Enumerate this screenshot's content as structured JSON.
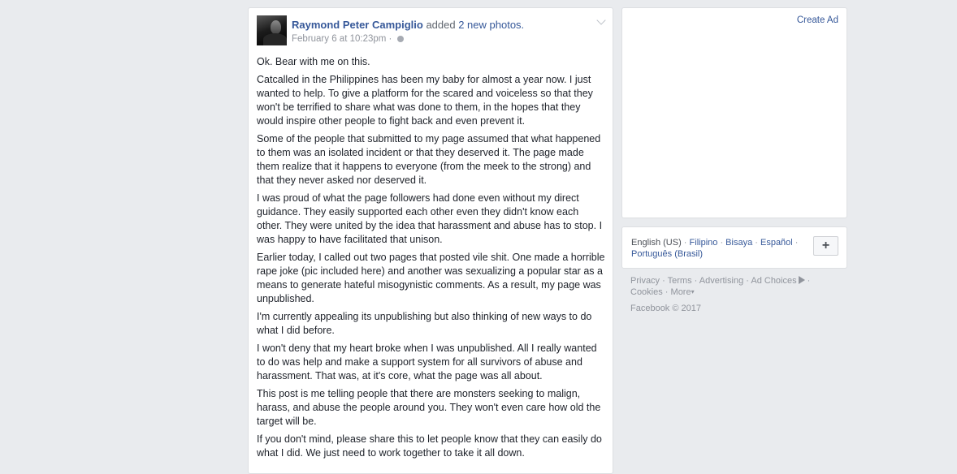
{
  "post": {
    "author": "Raymond Peter Campiglio",
    "action": "added",
    "photos_link": "2 new photos.",
    "timestamp": "February 6 at 10:23pm",
    "separator": "·",
    "paragraphs": [
      "Ok. Bear with me on this.",
      "Catcalled in the Philippines has been my baby for almost a year now. I just wanted to help. To give a platform for the scared and voiceless so that they won't be terrified to share what was done to them, in the hopes that they would inspire other people to fight back and even prevent it.",
      "Some of the people that submitted to my page assumed that what happened to them was an isolated incident or that they deserved it. The page made them realize that it happens to everyone (from the meek to the strong) and that they never asked nor deserved it.",
      "I was proud of what the page followers had done even without my direct guidance. They easily supported each other even they didn't know each other. They were united by the idea that harassment and abuse has to stop. I was happy to have facilitated that unison.",
      "Earlier today, I called out two pages that posted vile shit. One made a horrible rape joke (pic included here) and another was sexualizing a popular star as a means to generate hateful misogynistic comments. As a result, my page was unpublished.",
      "I'm currently appealing its unpublishing but also thinking of new ways to do what I did before.",
      "I won't deny that my heart broke when I was unpublished. All I really wanted to do was help and make a support system for all survivors of abuse and harassment. That was, at it's core, what the page was all about.",
      "This post is me telling people that there are monsters seeking to malign, harass, and abuse the people around you. They won't even care how old the target will be.",
      "If you don't mind, please share this to let people know that they can easily do what I did. We just need to work together to take it all down."
    ]
  },
  "sidebar": {
    "create_ad": "Create Ad",
    "languages": {
      "current": "English (US)",
      "others": [
        "Filipino",
        "Bisaya",
        "Español",
        "Português (Brasil)"
      ],
      "add_button": "+"
    },
    "footer": {
      "links": [
        "Privacy",
        "Terms",
        "Advertising",
        "Ad Choices",
        "Cookies",
        "More"
      ],
      "copyright": "Facebook © 2017"
    }
  },
  "colors": {
    "background": "#e9ebee",
    "link": "#365899",
    "text": "#1d2129",
    "muted": "#90949c"
  }
}
